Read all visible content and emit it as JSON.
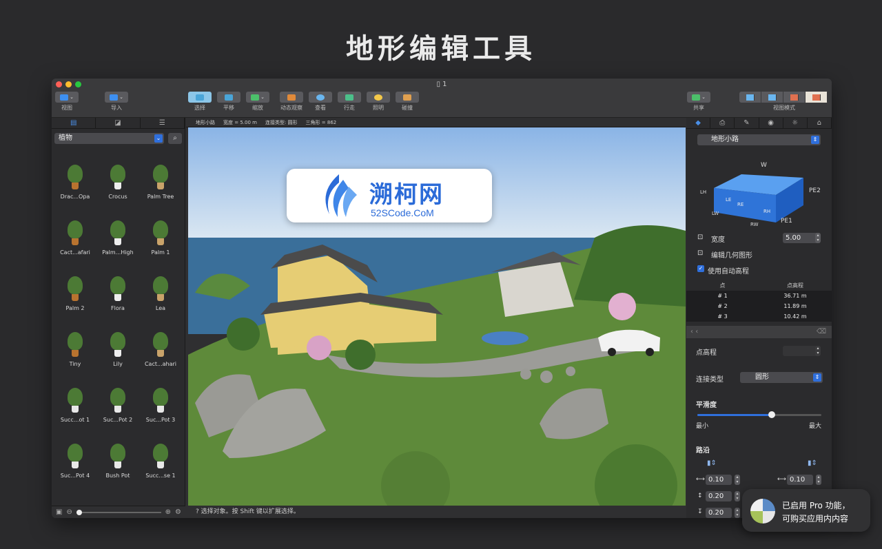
{
  "hero_title": "地形编辑工具",
  "window_title": "1",
  "toolbar": {
    "view": "视图",
    "import": "导入",
    "select": "选择",
    "pan": "平移",
    "zoom": "缩放",
    "orbit": "动态观察",
    "look": "查看",
    "walk": "行走",
    "lighting": "照明",
    "collision": "碰撞",
    "share": "共享",
    "view_mode": "视图模式"
  },
  "library": {
    "category": "植物",
    "items": [
      "Drac...Opa",
      "Crocus",
      "Palm Tree",
      "Cact...afari",
      "Palm...High",
      "Palm 1",
      "Palm 2",
      "Flora",
      "Lea",
      "Tiny",
      "Lily",
      "Cact...ahari",
      "Succ...ot 1",
      "Suc...Pot 2",
      "Suc...Pot 3",
      "Suc...Pot 4",
      "Bush Pot",
      "Succ...se 1"
    ]
  },
  "info": {
    "name": "地形小路",
    "width": "宽度 = 5.00 m",
    "connection": "连接类型: 圆形",
    "triangles": "三角形 = 862"
  },
  "status": "选择对象。按 Shift 键以扩展选择。",
  "watermark": {
    "title": "溯柯网",
    "url": "52SCode.CoM"
  },
  "inspector": {
    "object_type": "地形小路",
    "diagram_labels": {
      "w": "W",
      "lh": "LH",
      "le": "LE",
      "re": "RE",
      "lw": "LW",
      "rw": "RW",
      "rh": "RH",
      "pe1": "PE1",
      "pe2": "PE2"
    },
    "width_label": "宽度",
    "width_value": "5.00",
    "edit_geometry": "编辑几何图形",
    "auto_elevation": "使用自动高程",
    "table_headers": [
      "点",
      "点高程"
    ],
    "points": [
      {
        "id": "# 1",
        "elev": "36.71 m"
      },
      {
        "id": "# 2",
        "elev": "11.89 m"
      },
      {
        "id": "# 3",
        "elev": "10.42 m"
      }
    ],
    "point_elev_label": "点高程",
    "conn_type_label": "连接类型",
    "conn_type_value": "圆形",
    "smoothness_label": "平滑度",
    "smoothness_level": 0.6,
    "min_label": "最小",
    "max_label": "最大",
    "curb_label": "路沿",
    "curb_left_w": "0.10",
    "curb_right_w": "0.10",
    "curb_h1": "0.20",
    "curb_h2": "0.20"
  },
  "pro_badge": {
    "line1": "已启用 Pro 功能，",
    "line2": "可购买应用内内容"
  }
}
